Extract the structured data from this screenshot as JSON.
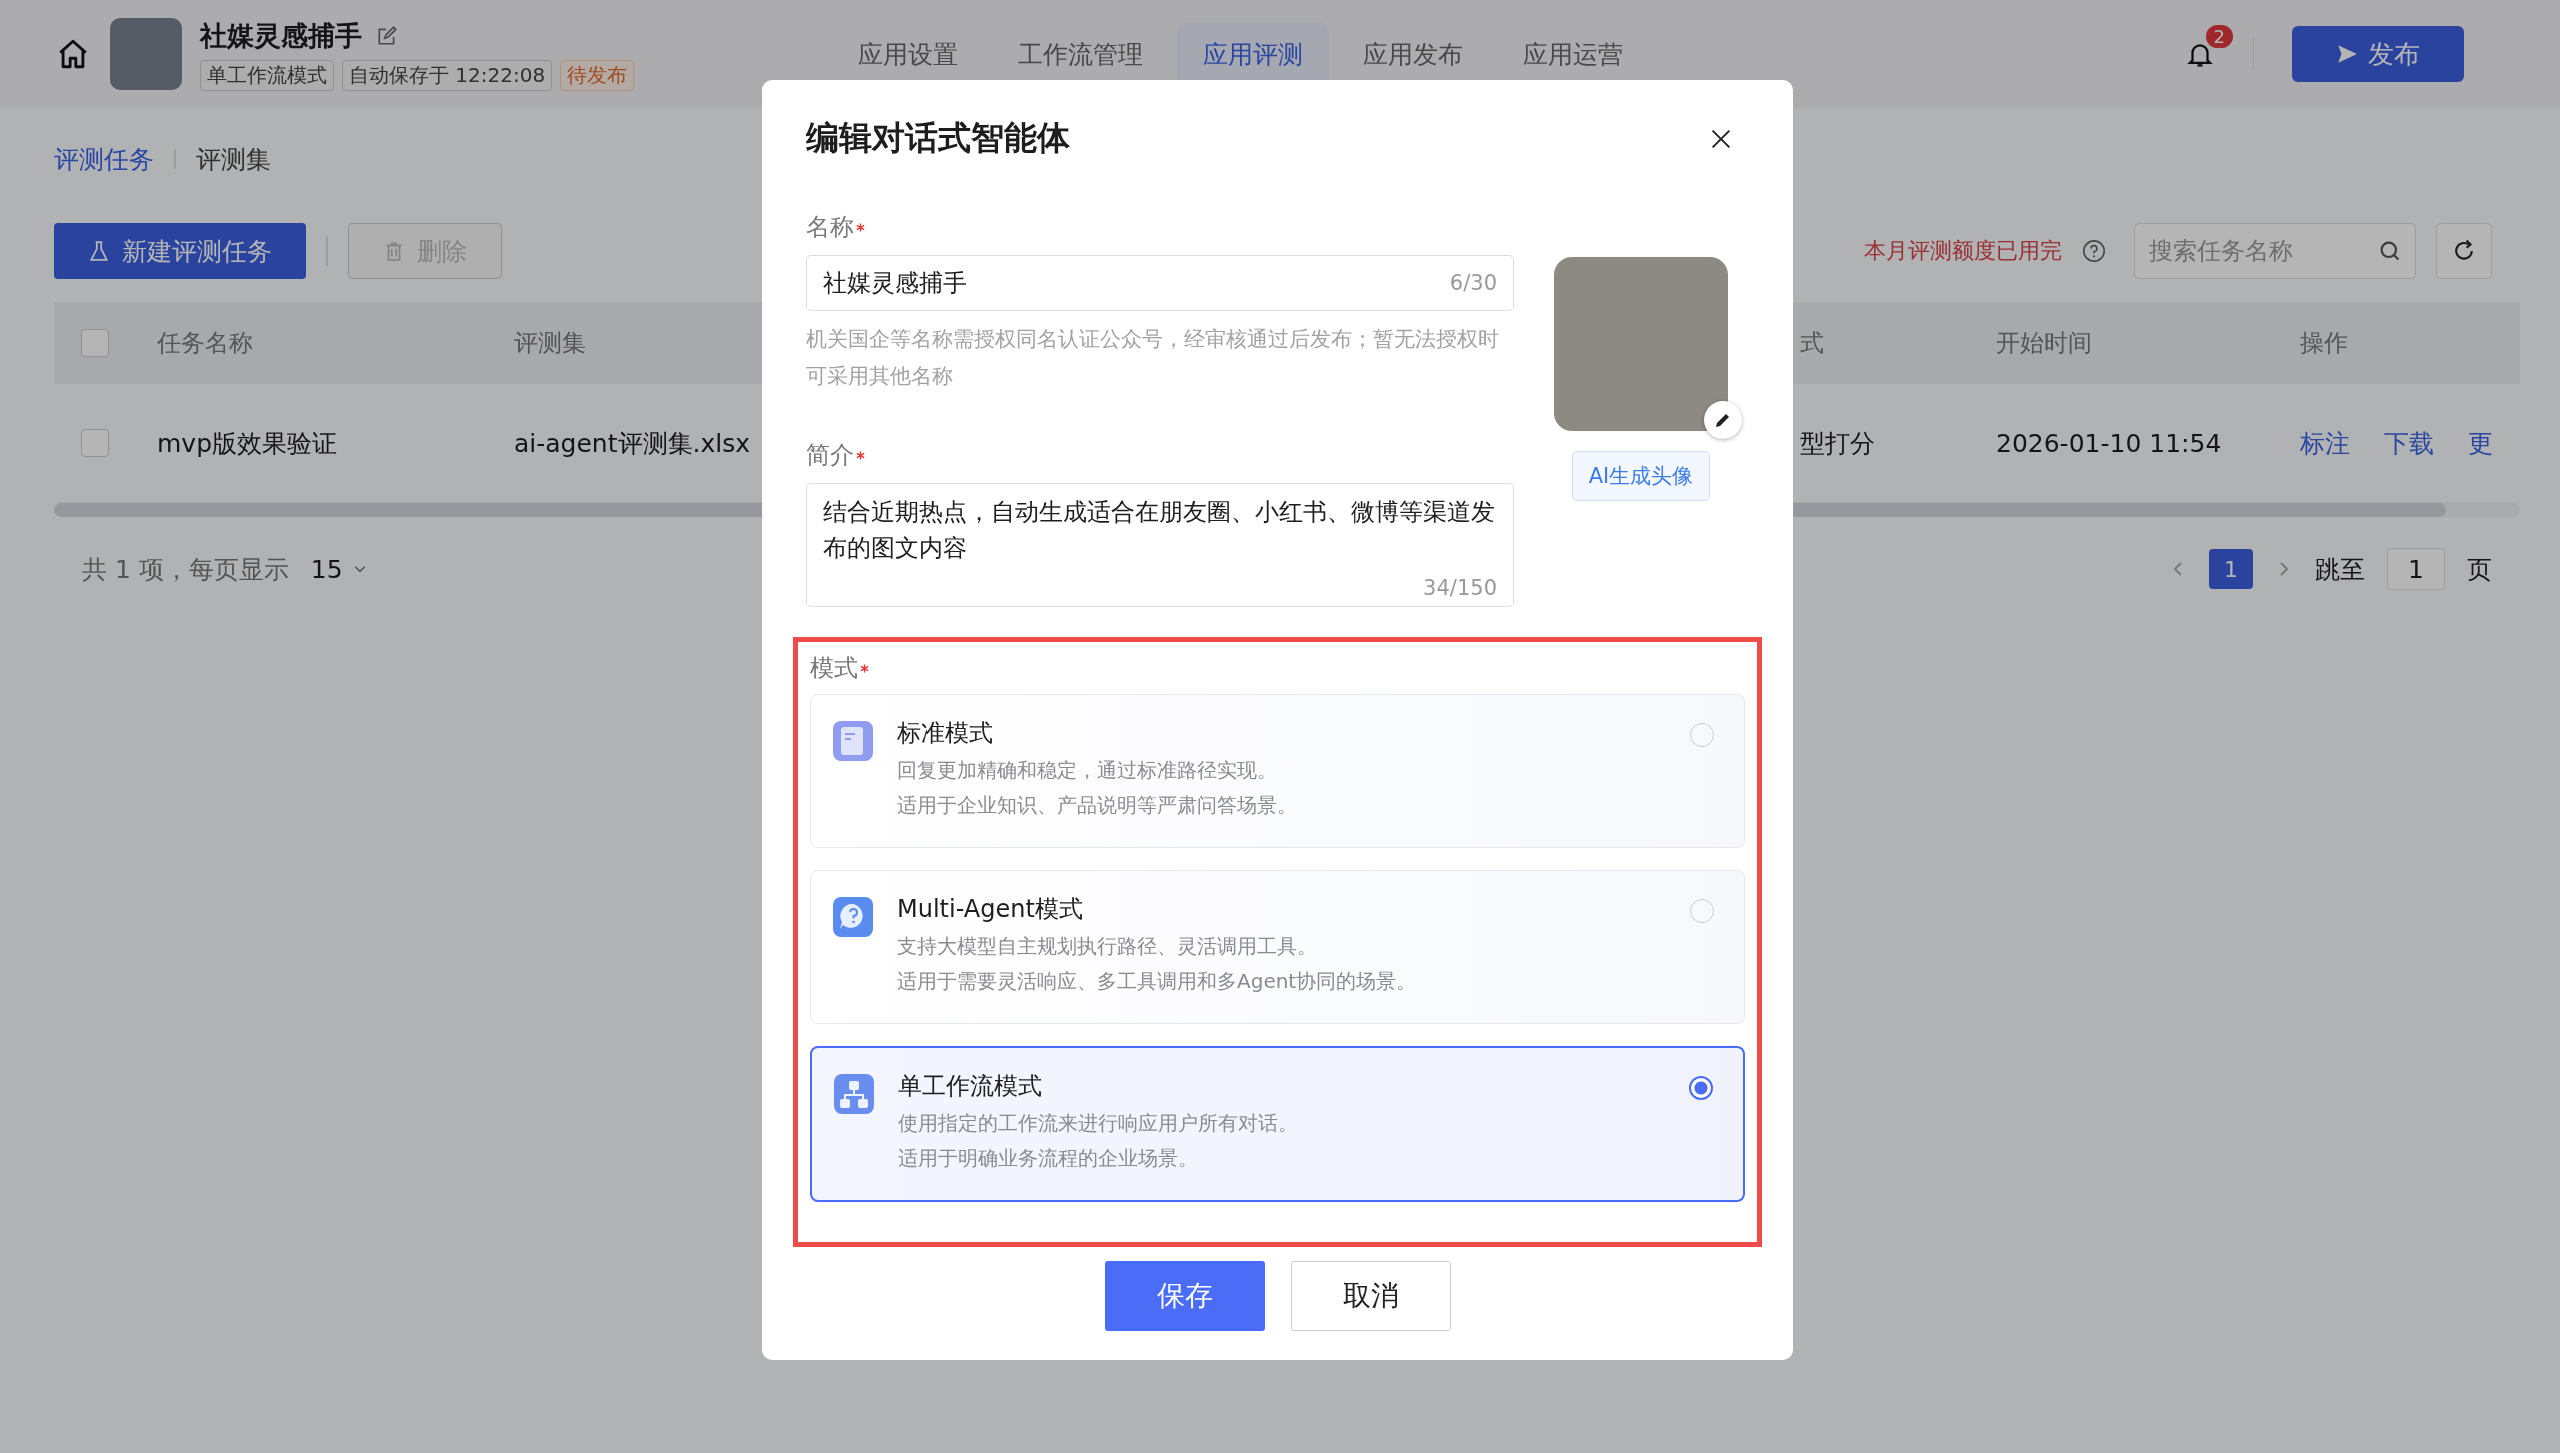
{
  "header": {
    "title": "社媒灵感捕手",
    "tags": [
      {
        "text": "单工作流模式",
        "kind": "neutral"
      },
      {
        "text": "自动保存于 12:22:08",
        "kind": "neutral"
      },
      {
        "text": "待发布",
        "kind": "warning"
      }
    ],
    "nav_tabs": [
      {
        "label": "应用设置",
        "selected": false
      },
      {
        "label": "工作流管理",
        "selected": false
      },
      {
        "label": "应用评测",
        "selected": true
      },
      {
        "label": "应用发布",
        "selected": false
      },
      {
        "label": "应用运营",
        "selected": false
      }
    ],
    "notification_badge": "2",
    "publish_button": "发布"
  },
  "subtabs": [
    {
      "label": "评测任务",
      "selected": true
    },
    {
      "label": "评测集",
      "selected": false
    }
  ],
  "toolbar": {
    "buttons": [
      {
        "label": "新建评测任务",
        "kind": "primary",
        "disabled": false
      },
      {
        "label": "删除",
        "kind": "delete",
        "disabled": true
      }
    ],
    "quota_notice": "本月评测额度已用完",
    "search": {
      "placeholder": "搜索任务名称"
    }
  },
  "table": {
    "select_all_checked": false,
    "columns": [
      "任务名称",
      "评测集",
      "式",
      "开始时间",
      "操作"
    ],
    "rows": [
      {
        "checked": false,
        "cells": [
          "mvp版效果验证",
          "ai-agent评测集.xlsx",
          "型打分",
          "2026-01-10 11:54"
        ],
        "actions": [
          "标注",
          "下载",
          "更"
        ]
      }
    ]
  },
  "pagination": {
    "summary": "共 1 项，每页显示",
    "page_size": "15",
    "pages": [
      {
        "label": "1",
        "selected": true
      }
    ],
    "jump_label": "跳至",
    "jump_value": "1",
    "page_suffix": "页"
  },
  "dialog": {
    "title": "编辑对话式智能体",
    "name_field": {
      "label": "名称",
      "value": "社媒灵感捕手",
      "count": "6/30",
      "hint": "机关国企等名称需授权同名认证公众号，经审核通过后发布；暂无法授权时可采用其他名称"
    },
    "intro_field": {
      "label": "简介",
      "value": "结合近期热点，自动生成适合在朋友圈、小红书、微博等渠道发布的图文内容",
      "count": "34/150"
    },
    "ai_avatar_button": "AI生成头像",
    "mode_label": "模式",
    "modes": [
      {
        "kind": "standard",
        "title": "标准模式",
        "lines": [
          "回复更加精确和稳定，通过标准路径实现。",
          "适用于企业知识、产品说明等严肃问答场景。"
        ],
        "selected": false
      },
      {
        "kind": "agent",
        "title": "Multi-Agent模式",
        "lines": [
          "支持大模型自主规划执行路径、灵活调用工具。",
          "适用于需要灵活响应、多工具调用和多Agent协同的场景。"
        ],
        "selected": false
      },
      {
        "kind": "workflow",
        "title": "单工作流模式",
        "lines": [
          "使用指定的工作流来进行响应用户所有对话。",
          "适用于明确业务流程的企业场景。"
        ],
        "selected": true
      }
    ],
    "buttons": [
      {
        "label": "保存",
        "kind": "primary"
      },
      {
        "label": "取消",
        "kind": "default"
      }
    ]
  }
}
